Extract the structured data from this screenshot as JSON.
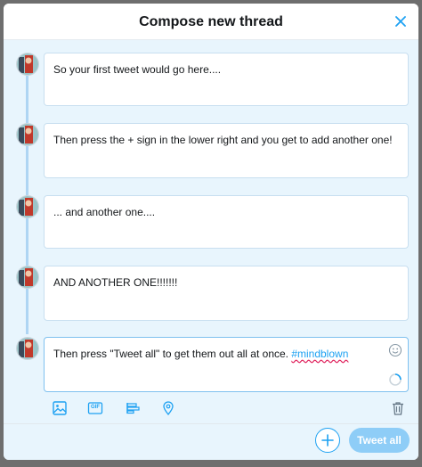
{
  "dialog": {
    "title": "Compose new thread"
  },
  "tweets": [
    {
      "text": "So your first tweet would go here...."
    },
    {
      "text": "Then press the + sign in the lower right and you get to add another one!"
    },
    {
      "text": "... and another one...."
    },
    {
      "text": "AND ANOTHER ONE!!!!!!!"
    },
    {
      "text_before": "Then press \"Tweet all\" to get them out all at once. ",
      "hashtag": "#mindblown"
    }
  ],
  "toolbar": {
    "gif_label": "GIF"
  },
  "footer": {
    "tweet_all_label": "Tweet all"
  },
  "colors": {
    "accent": "#1da1f2",
    "button_disabled": "#8ecdf7",
    "thread_background": "#e8f5fd"
  },
  "icons": [
    "close-icon",
    "image-icon",
    "gif-icon",
    "poll-icon",
    "location-icon",
    "trash-icon",
    "emoji-icon",
    "plus-icon"
  ]
}
